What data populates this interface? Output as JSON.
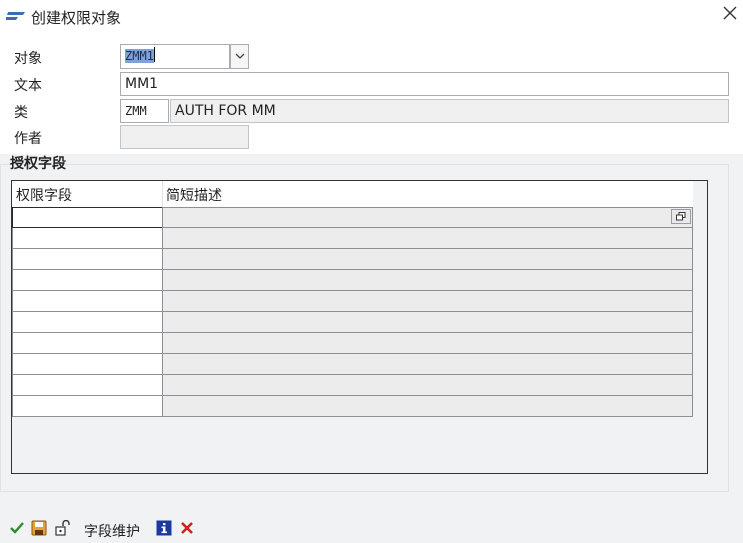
{
  "window": {
    "title": "创建权限对象",
    "close_icon": "close-icon"
  },
  "form": {
    "object_label": "对象",
    "object_value": "ZMM1",
    "text_label": "文本",
    "text_value": "MM1",
    "class_label": "类",
    "class_code": "ZMM",
    "class_description": "AUTH FOR MM",
    "author_label": "作者",
    "author_value": ""
  },
  "fields_section": {
    "title": "授权字段",
    "columns": [
      "权限字段",
      "简短描述"
    ],
    "rows": [
      {
        "field": "",
        "description": ""
      },
      {
        "field": "",
        "description": ""
      },
      {
        "field": "",
        "description": ""
      },
      {
        "field": "",
        "description": ""
      },
      {
        "field": "",
        "description": ""
      },
      {
        "field": "",
        "description": ""
      },
      {
        "field": "",
        "description": ""
      },
      {
        "field": "",
        "description": ""
      },
      {
        "field": "",
        "description": ""
      },
      {
        "field": "",
        "description": ""
      }
    ]
  },
  "toolbar": {
    "confirm_icon": "checkmark-icon",
    "save_icon": "save-icon",
    "lock_icon": "lock-icon",
    "field_maintenance_label": "字段维护",
    "info_icon": "info-icon",
    "cancel_icon": "cancel-icon"
  },
  "colors": {
    "accent": "#3a6fb8",
    "selection": "#7ea2d7",
    "cancel": "#d0201c",
    "confirm": "#2f8a2f"
  }
}
